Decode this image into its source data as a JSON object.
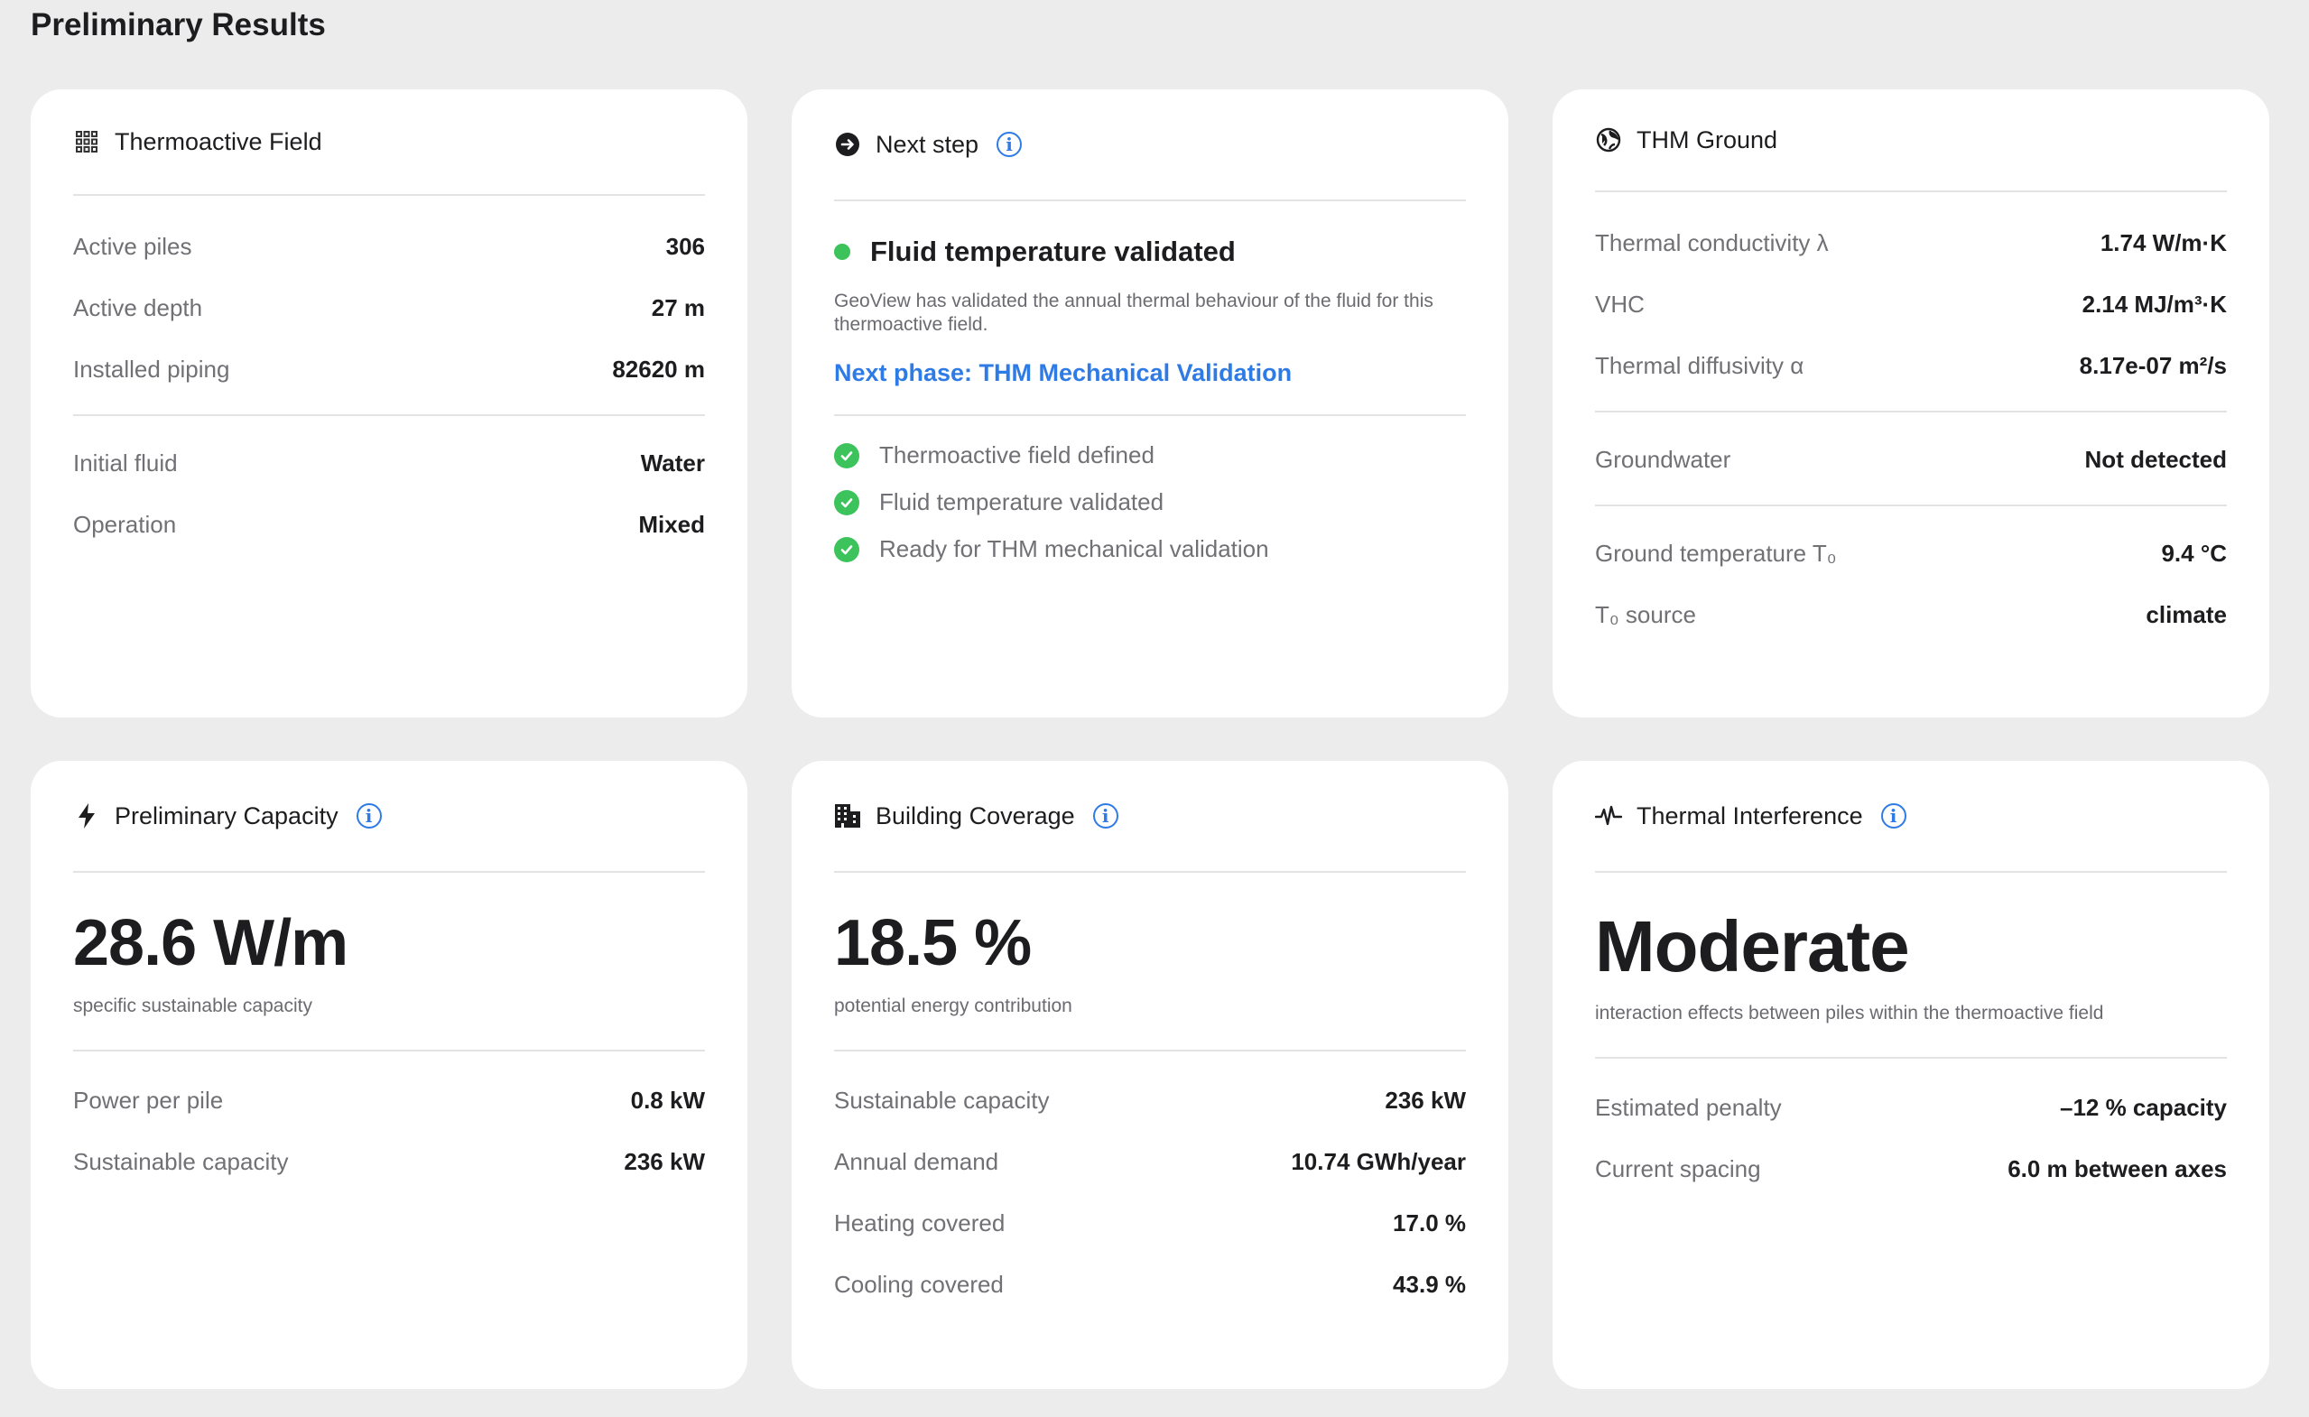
{
  "page_title": "Preliminary Results",
  "thermoactive_field": {
    "title": "Thermoactive Field",
    "icon": "grid-icon",
    "rows_a": [
      {
        "label": "Active piles",
        "value": "306"
      },
      {
        "label": "Active depth",
        "value": "27 m"
      },
      {
        "label": "Installed piping",
        "value": "82620 m"
      }
    ],
    "rows_b": [
      {
        "label": "Initial fluid",
        "value": "Water"
      },
      {
        "label": "Operation",
        "value": "Mixed"
      }
    ]
  },
  "next_step": {
    "title": "Next step",
    "icon": "arrow-circle-icon",
    "status": "Fluid temperature validated",
    "status_color": "#3cc35b",
    "description": "GeoView has validated the annual thermal behaviour of the fluid for this thermoactive field.",
    "link": "Next phase: THM Mechanical Validation",
    "link_color": "#2f7be5",
    "checks": [
      "Thermoactive field defined",
      "Fluid temperature validated",
      "Ready for THM mechanical validation"
    ]
  },
  "thm_ground": {
    "title": "THM Ground",
    "icon": "globe-icon",
    "rows_a": [
      {
        "label": "Thermal conductivity λ",
        "value": "1.74 W/m·K"
      },
      {
        "label": "VHC",
        "value": "2.14 MJ/m³·K"
      },
      {
        "label": "Thermal diffusivity α",
        "value": "8.17e-07 m²/s"
      }
    ],
    "rows_b": [
      {
        "label": "Groundwater",
        "value": "Not detected"
      }
    ],
    "rows_c": [
      {
        "label": "Ground temperature T₀",
        "value": "9.4 °C"
      },
      {
        "label": "T₀ source",
        "value": "climate"
      }
    ]
  },
  "preliminary_capacity": {
    "title": "Preliminary Capacity",
    "icon": "bolt-icon",
    "big_value": "28.6 W/m",
    "big_caption": "specific sustainable capacity",
    "rows": [
      {
        "label": "Power per pile",
        "value": "0.8 kW"
      },
      {
        "label": "Sustainable capacity",
        "value": "236 kW"
      }
    ]
  },
  "building_coverage": {
    "title": "Building Coverage",
    "icon": "building-icon",
    "big_value": "18.5 %",
    "big_caption": "potential energy contribution",
    "rows": [
      {
        "label": "Sustainable capacity",
        "value": "236 kW"
      },
      {
        "label": "Annual demand",
        "value": "10.74 GWh/year"
      },
      {
        "label": "Heating covered",
        "value": "17.0 %"
      },
      {
        "label": "Cooling covered",
        "value": "43.9 %"
      }
    ]
  },
  "thermal_interference": {
    "title": "Thermal Interference",
    "icon": "pulse-icon",
    "big_value": "Moderate",
    "big_caption": "interaction effects between piles within the thermoactive field",
    "rows": [
      {
        "label": "Estimated penalty",
        "value": "–12 % capacity"
      },
      {
        "label": "Current spacing",
        "value": "6.0 m between axes"
      }
    ]
  },
  "info_glyph": "i"
}
